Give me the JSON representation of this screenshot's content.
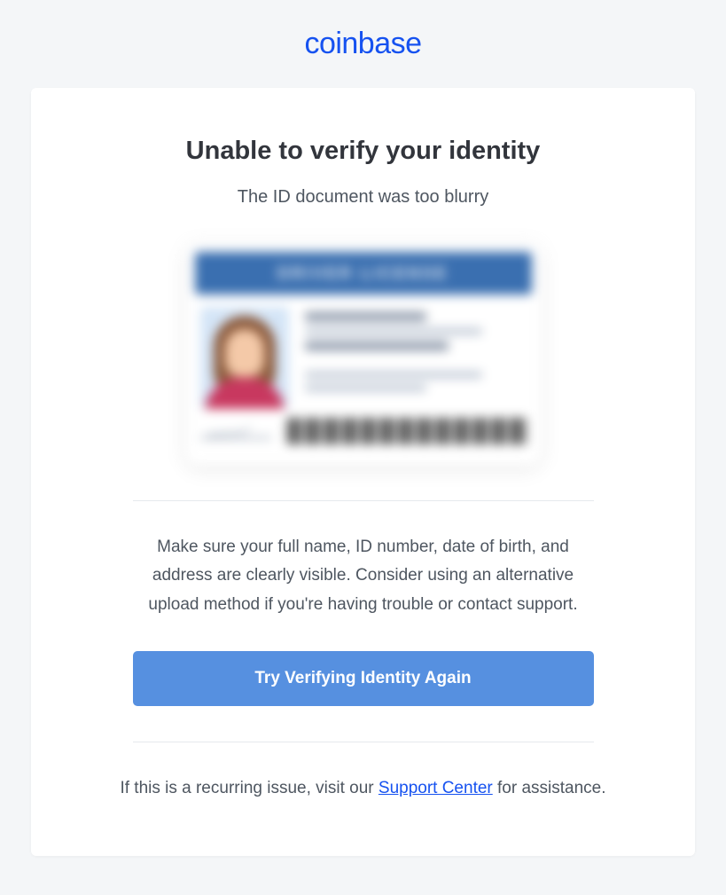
{
  "brand": {
    "name": "coinbase"
  },
  "card": {
    "heading": "Unable to verify your identity",
    "reason": "The ID document was too blurry",
    "instructions": "Make sure your full name, ID number, date of birth, and address are clearly visible. Consider using an alternative upload method if you're having trouble or contact support.",
    "cta_label": "Try Verifying Identity Again",
    "footer_prefix": "If this is a recurring issue, visit our ",
    "footer_link_label": "Support Center",
    "footer_suffix": " for assistance."
  },
  "id_sample": {
    "header_text": "DRIVER LICENSE"
  }
}
